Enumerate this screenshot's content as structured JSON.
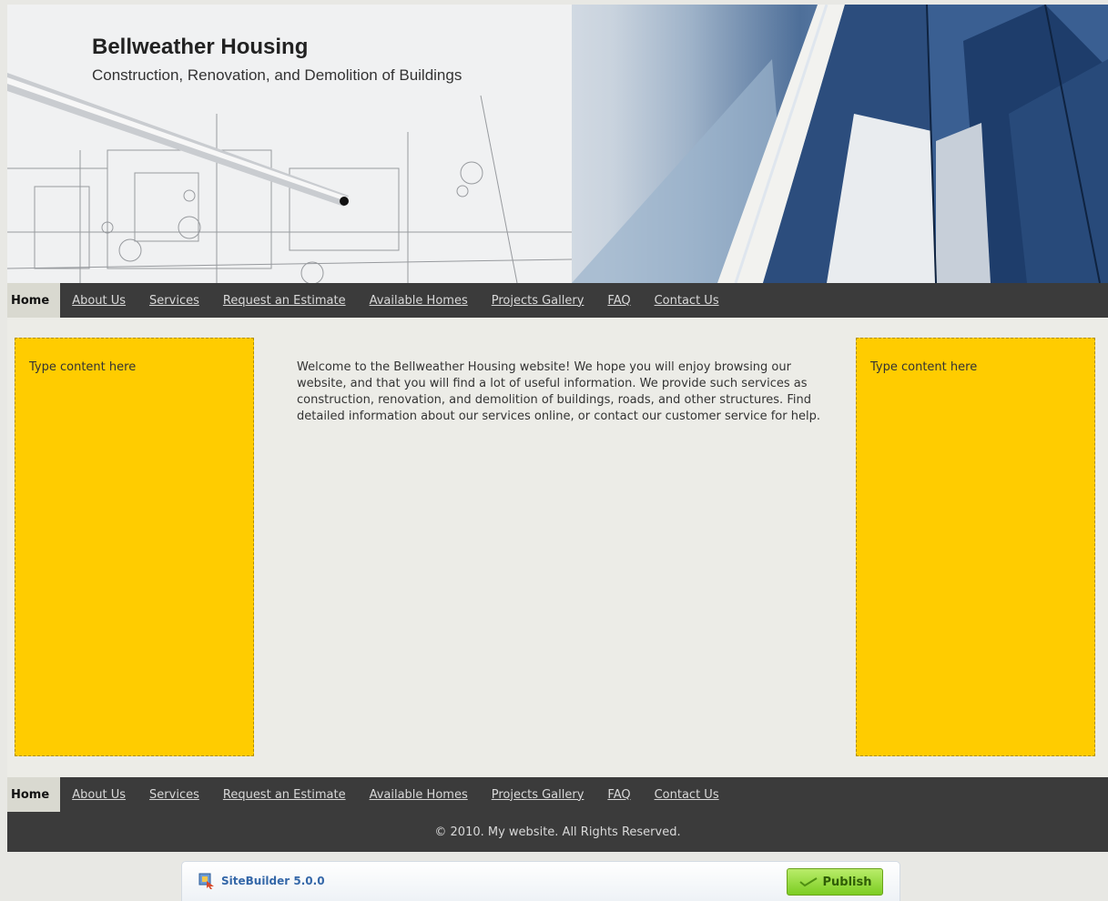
{
  "header": {
    "title": "Bellweather Housing",
    "subtitle": "Construction, Renovation, and Demolition of Buildings"
  },
  "nav": {
    "items": [
      {
        "label": "Home",
        "active": true
      },
      {
        "label": "About Us"
      },
      {
        "label": "Services"
      },
      {
        "label": "Request an Estimate"
      },
      {
        "label": "Available Homes"
      },
      {
        "label": "Projects Gallery"
      },
      {
        "label": "FAQ"
      },
      {
        "label": "Contact Us"
      }
    ]
  },
  "left_sidebar": {
    "text": "Type content here"
  },
  "right_sidebar": {
    "text": "Type content here"
  },
  "main": {
    "text": "Welcome to the Bellweather Housing website! We hope you will enjoy browsing our website, and that you will find a lot of useful information. We provide such services as construction, renovation, and demolition of buildings, roads, and other structures. Find detailed information about our services online, or contact our customer service for help."
  },
  "footer": {
    "copyright": "© 2010. My website. All Rights Reserved."
  },
  "sitebuilder": {
    "label": "SiteBuilder 5.0.0",
    "publish_label": "Publish",
    "logo_icon": "sitebuilder-logo-icon",
    "publish_icon": "checkmark-icon"
  },
  "colors": {
    "nav_bg": "#3b3b3b",
    "sidebar_bg": "#ffcc00",
    "content_bg": "#ecece7",
    "publish_green": "#7ccd22"
  }
}
